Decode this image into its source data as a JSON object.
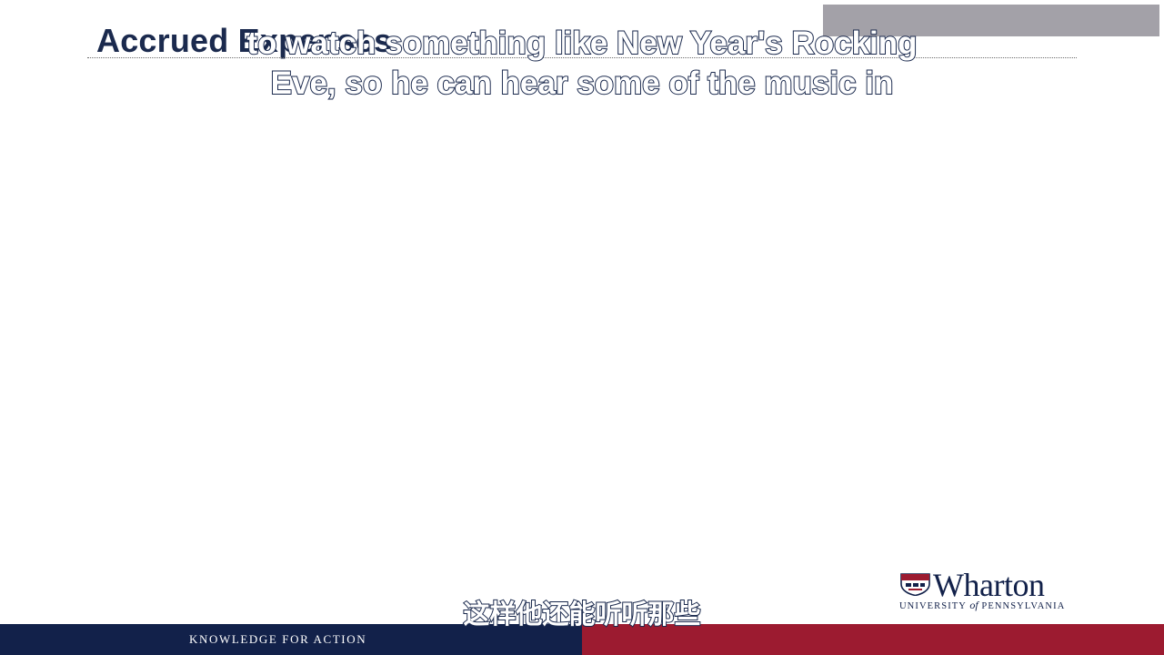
{
  "slide": {
    "title": "Accrued Expenses"
  },
  "subtitles": {
    "english_line1": "to watch something like New Year's Rocking",
    "english_line2": "Eve, so he can hear some of the music in",
    "chinese": "这样他还能听听那些"
  },
  "footer": {
    "tagline": "KNOWLEDGE FOR ACTION",
    "left_color": "#12214a",
    "right_color": "#9c1b30"
  },
  "logo": {
    "wordmark": "Wharton",
    "university_prefix": "UNIVERSITY",
    "university_of": "of",
    "university_suffix": "PENNSYLVANIA",
    "icon": "penn-shield-icon"
  },
  "colors": {
    "title": "#1b2a4e",
    "overlay": "#a3a1a8"
  }
}
